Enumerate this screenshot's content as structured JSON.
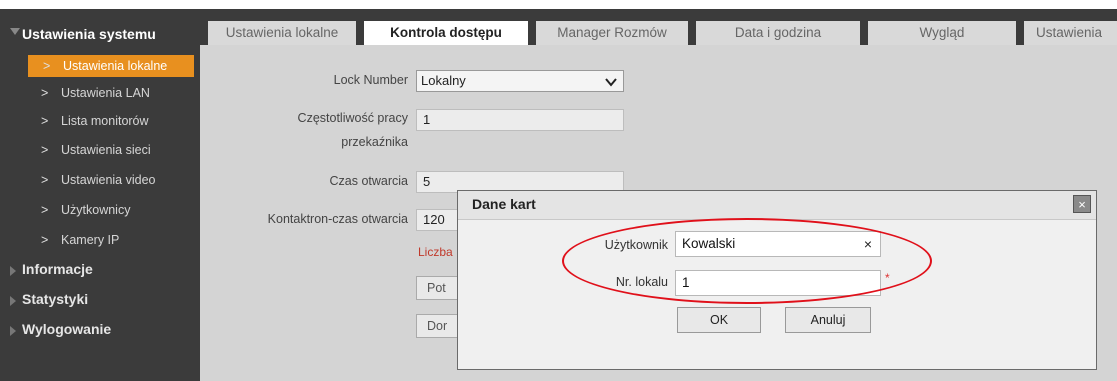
{
  "sidebar": {
    "header": "Ustawienia systemu",
    "items": [
      {
        "label": "Ustawienia lokalne",
        "active": true
      },
      {
        "label": "Ustawienia LAN"
      },
      {
        "label": "Lista monitorów"
      },
      {
        "label": "Ustawienia sieci"
      },
      {
        "label": "Ustawienia video"
      },
      {
        "label": "Użytkownicy"
      },
      {
        "label": "Kamery IP"
      }
    ],
    "groups": [
      "Informacje",
      "Statystyki",
      "Wylogowanie"
    ],
    "chevron": ">"
  },
  "tabs": [
    {
      "label": "Ustawienia lokalne"
    },
    {
      "label": "Kontrola dostępu",
      "active": true
    },
    {
      "label": "Manager Rozmów"
    },
    {
      "label": "Data i godzina"
    },
    {
      "label": "Wygląd"
    },
    {
      "label": "Ustawienia"
    }
  ],
  "form": {
    "lock_number_label": "Lock Number",
    "lock_number_value": "Lokalny",
    "relay_freq_label_1": "Częstotliwość pracy",
    "relay_freq_label_2": "przekaźnika",
    "relay_freq_value": "1",
    "open_time_label": "Czas otwarcia",
    "open_time_value": "5",
    "contactron_label": "Kontaktron-czas otwarcia",
    "contactron_value": "120",
    "hint_partial": "Liczba",
    "button1_partial": "Pot",
    "button2_partial": "Dor",
    "dropdown_icon": "chevron-down"
  },
  "modal": {
    "title": "Dane kart",
    "close_icon": "×",
    "user_label": "Użytkownik",
    "user_value": "Kowalski",
    "clear_icon": "×",
    "unit_label": "Nr. lokalu",
    "unit_value": "1",
    "required_mark": "*",
    "ok_label": "OK",
    "cancel_label": "Anuluj"
  },
  "colors": {
    "sidebar_bg": "#3b3b3b",
    "active_item": "#e8901f",
    "highlight_ellipse": "#e0101a"
  }
}
